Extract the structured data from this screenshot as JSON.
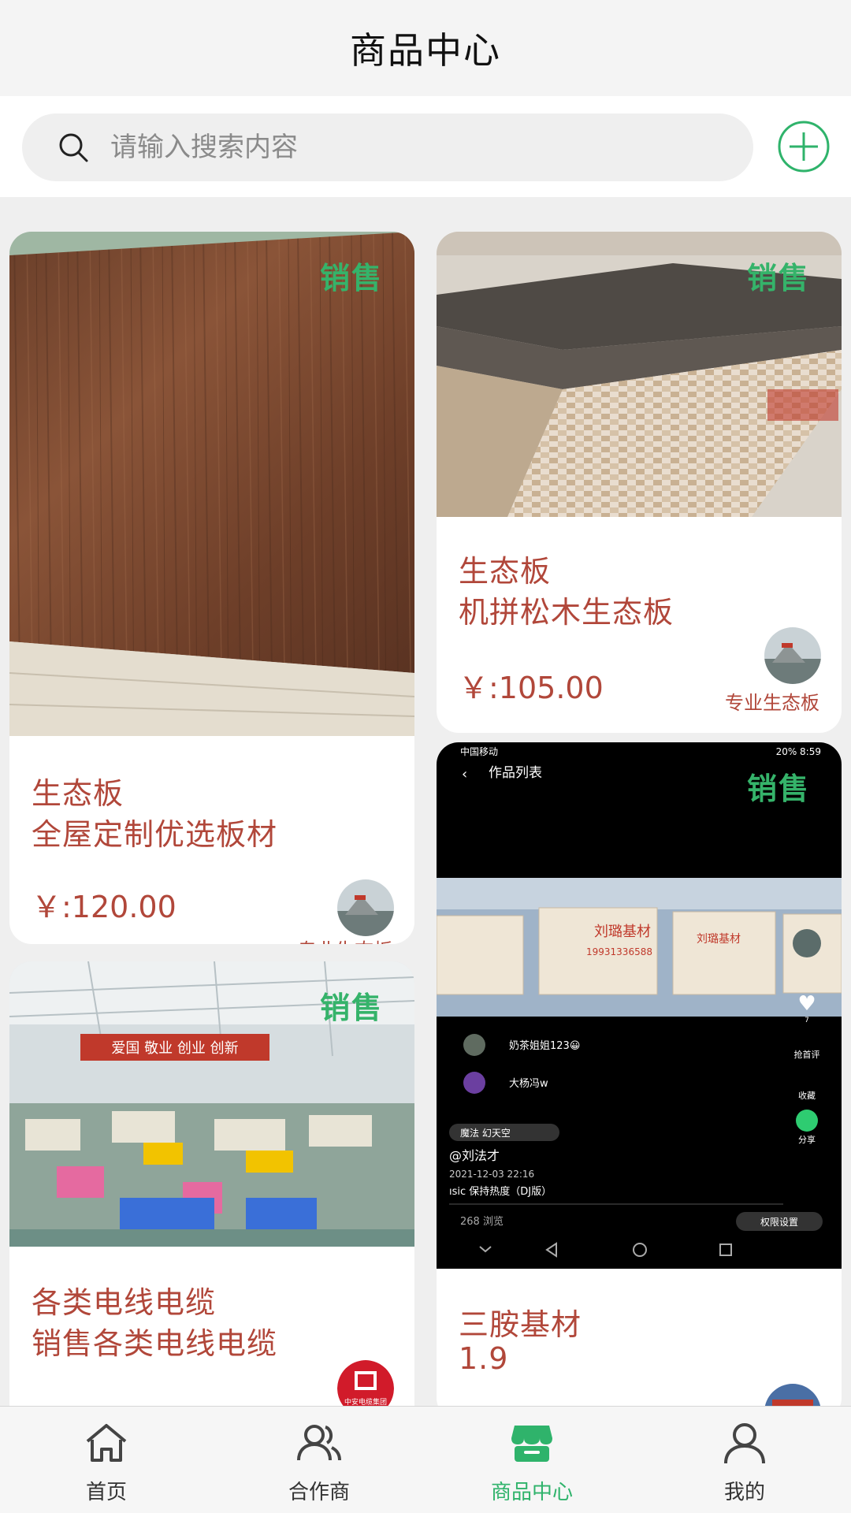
{
  "header": {
    "title": "商品中心"
  },
  "search": {
    "placeholder": "请输入搜索内容"
  },
  "products": [
    {
      "badge": "销售",
      "category": "生态板",
      "description": "全屋定制优选板材",
      "price": "￥:120.00",
      "seller": "专业生态板"
    },
    {
      "badge": "销售",
      "category": "生态板",
      "description": "机拼松木生态板",
      "price": "￥:105.00",
      "seller": "专业生态板"
    },
    {
      "badge": "销售",
      "category": "各类电线电缆",
      "description": "销售各类电线电缆",
      "price": "",
      "seller": "",
      "photo_text": {
        "banner": "爱国  敬业  创业  创新"
      },
      "avatar_text": "中安电缆集团"
    },
    {
      "badge": "销售",
      "category": "三胺基材",
      "description": "1.9",
      "price": "",
      "seller": "",
      "screenshot": {
        "status_left": "中国移动",
        "status_right": "20% 8:59",
        "back_title": "作品列表",
        "board_text_1": "刘璐基材",
        "board_text_2": "刘璐基材",
        "board_phone": "19931336588",
        "comments": [
          {
            "name": "奶茶姐姐123😀"
          },
          {
            "name": "大杨冯w"
          }
        ],
        "side": [
          "抢首评",
          "收藏",
          "分享"
        ],
        "like_count": "7",
        "music_tag": "魔法  幻天空",
        "author": "@刘法才",
        "date": "2021-12-03 22:16",
        "song": "ısic    保持热度（DJ版）",
        "views": "268 浏览",
        "permission": "权限设置"
      }
    }
  ],
  "bottom_nav": [
    {
      "label": "首页",
      "icon": "home-icon",
      "active": false
    },
    {
      "label": "合作商",
      "icon": "partners-icon",
      "active": false
    },
    {
      "label": "商品中心",
      "icon": "store-icon",
      "active": true
    },
    {
      "label": "我的",
      "icon": "profile-icon",
      "active": false
    }
  ],
  "colors": {
    "accent": "#2fb36b",
    "price": "#b1473a",
    "badge": "#35b36a"
  }
}
